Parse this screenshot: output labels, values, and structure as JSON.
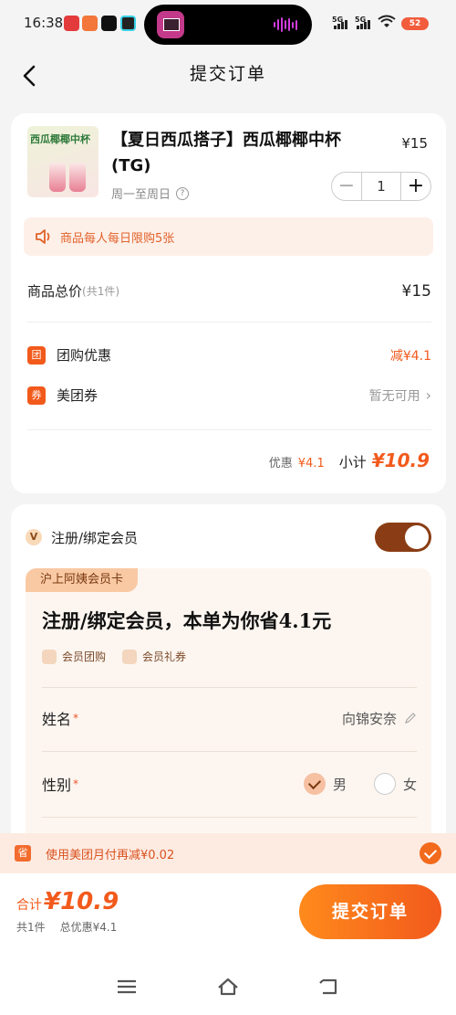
{
  "status": {
    "time": "16:38",
    "net1": "5G",
    "net2": "5G",
    "battery": "52"
  },
  "header": {
    "title": "提交订单"
  },
  "product": {
    "thumb_label": "西瓜椰椰中杯",
    "name": "【夏日西瓜搭子】西瓜椰椰中杯(TG)",
    "price": "¥15",
    "validity": "周一至周日",
    "quantity": "1",
    "minus": "−",
    "plus": "+",
    "limit_notice": "商品每人每日限购5张"
  },
  "summary": {
    "goods_total_label": "商品总价",
    "goods_total_count": "(共1件)",
    "goods_total_value": "¥15",
    "group_icon": "团",
    "group_label": "团购优惠",
    "group_value": "减¥4.1",
    "coupon_icon": "券",
    "coupon_label": "美团券",
    "coupon_value": "暂无可用",
    "discount_label": "优惠",
    "discount_value": "¥4.1",
    "subtotal_label": "小计",
    "subtotal_value": "¥10.9"
  },
  "member": {
    "v_icon": "V",
    "toggle_label": "注册/绑定会员",
    "toggle_on": true,
    "card_tag": "沪上阿姨会员卡",
    "headline": "注册/绑定会员，本单为你省4.1元",
    "perk1": "会员团购",
    "perk2": "会员礼券",
    "name_label": "姓名",
    "name_required": "*",
    "name_value": "向锦安奈",
    "gender_label": "性别",
    "gender_required": "*",
    "gender_male": "男",
    "gender_female": "女",
    "gender_selected": "男"
  },
  "pay_banner": {
    "icon": "省",
    "text": "使用美团月付再减¥0.02",
    "checked": true
  },
  "bottom": {
    "total_label": "合计",
    "total_value": "¥10.9",
    "count": "共1件",
    "total_discount": "总优惠¥4.1",
    "submit": "提交订单"
  },
  "colors": {
    "accent": "#f25a1c",
    "toggle": "#8a3d14",
    "tag_bg": "#f9c9a4"
  },
  "icons": [
    "back-arrow-icon",
    "speaker-icon",
    "help-icon",
    "pencil-icon",
    "check-icon",
    "menu-icon",
    "home-icon",
    "return-icon"
  ]
}
